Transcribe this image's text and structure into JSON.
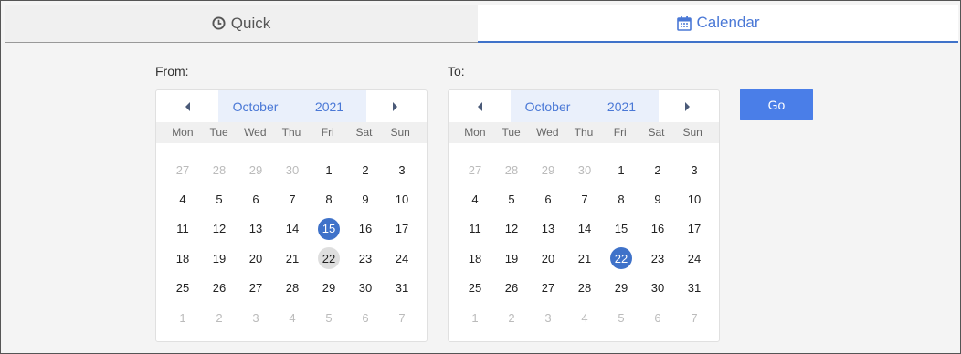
{
  "tabs": {
    "quick": {
      "label": "Quick",
      "icon": "clock-icon"
    },
    "calendar": {
      "label": "Calendar",
      "icon": "calendar-icon"
    }
  },
  "from": {
    "label": "From:",
    "month": "October",
    "year": "2021",
    "selected": "15",
    "highlighted": "22"
  },
  "to": {
    "label": "To:",
    "month": "October",
    "year": "2021",
    "selected": "22"
  },
  "weekdays": [
    "Mon",
    "Tue",
    "Wed",
    "Thu",
    "Fri",
    "Sat",
    "Sun"
  ],
  "weeks": [
    [
      "27",
      "28",
      "29",
      "30",
      "1",
      "2",
      "3"
    ],
    [
      "4",
      "5",
      "6",
      "7",
      "8",
      "9",
      "10"
    ],
    [
      "11",
      "12",
      "13",
      "14",
      "15",
      "16",
      "17"
    ],
    [
      "18",
      "19",
      "20",
      "21",
      "22",
      "23",
      "24"
    ],
    [
      "25",
      "26",
      "27",
      "28",
      "29",
      "30",
      "31"
    ],
    [
      "1",
      "2",
      "3",
      "4",
      "5",
      "6",
      "7"
    ]
  ],
  "go_label": "Go",
  "colors": {
    "accent": "#4a78d6",
    "selected": "#3f72c9",
    "button": "#4a7ee8"
  }
}
